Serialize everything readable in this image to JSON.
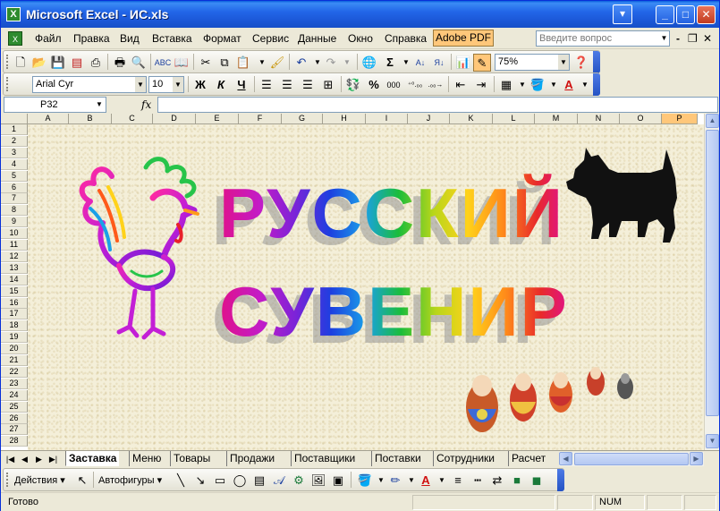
{
  "window": {
    "title": "Microsoft Excel - ИС.xls",
    "app_icon_glyph": "X"
  },
  "menu": {
    "items": [
      "Файл",
      "Правка",
      "Вид",
      "Вставка",
      "Формат",
      "Сервис",
      "Данные",
      "Окно",
      "Справка"
    ],
    "adobe_pdf": "Adobe PDF",
    "ask_placeholder": "Введите вопрос"
  },
  "formatting": {
    "font_name": "Arial Cyr",
    "font_size": "10",
    "bold": "Ж",
    "italic": "К",
    "underline": "Ч",
    "percent": "%",
    "thousands": "000"
  },
  "standard_toolbar": {
    "zoom": "75%",
    "sum": "Σ"
  },
  "formula_bar": {
    "name_box": "P32",
    "fx": "fx",
    "formula": ""
  },
  "columns": [
    "A",
    "B",
    "C",
    "D",
    "E",
    "F",
    "G",
    "H",
    "I",
    "J",
    "K",
    "L",
    "M",
    "N",
    "O",
    "P"
  ],
  "selected_column": "P",
  "rows": [
    "1",
    "2",
    "3",
    "4",
    "5",
    "6",
    "7",
    "8",
    "9",
    "10",
    "11",
    "12",
    "13",
    "14",
    "15",
    "16",
    "17",
    "18",
    "19",
    "20",
    "21",
    "22",
    "23",
    "24",
    "25",
    "26",
    "27",
    "28"
  ],
  "sheet_art": {
    "line1": "РУССКИЙ",
    "line2": "СУВЕНИР",
    "images": [
      "rooster-picture",
      "scottish-terrier-silhouette",
      "matryoshka-dolls"
    ]
  },
  "sheet_tabs": [
    "Заставка",
    "Меню",
    "Товары",
    "Продажи",
    "Поставщики",
    "Поставки",
    "Сотрудники",
    "Расчет"
  ],
  "active_tab": "Заставка",
  "drawing_toolbar": {
    "actions": "Действия",
    "autoshapes": "Автофигуры"
  },
  "status": {
    "text": "Готово",
    "num": "NUM"
  },
  "colors": {
    "titlebar": "#2266e8",
    "selected_header": "#ffc77a",
    "sheet_background": "#f4efd9"
  }
}
